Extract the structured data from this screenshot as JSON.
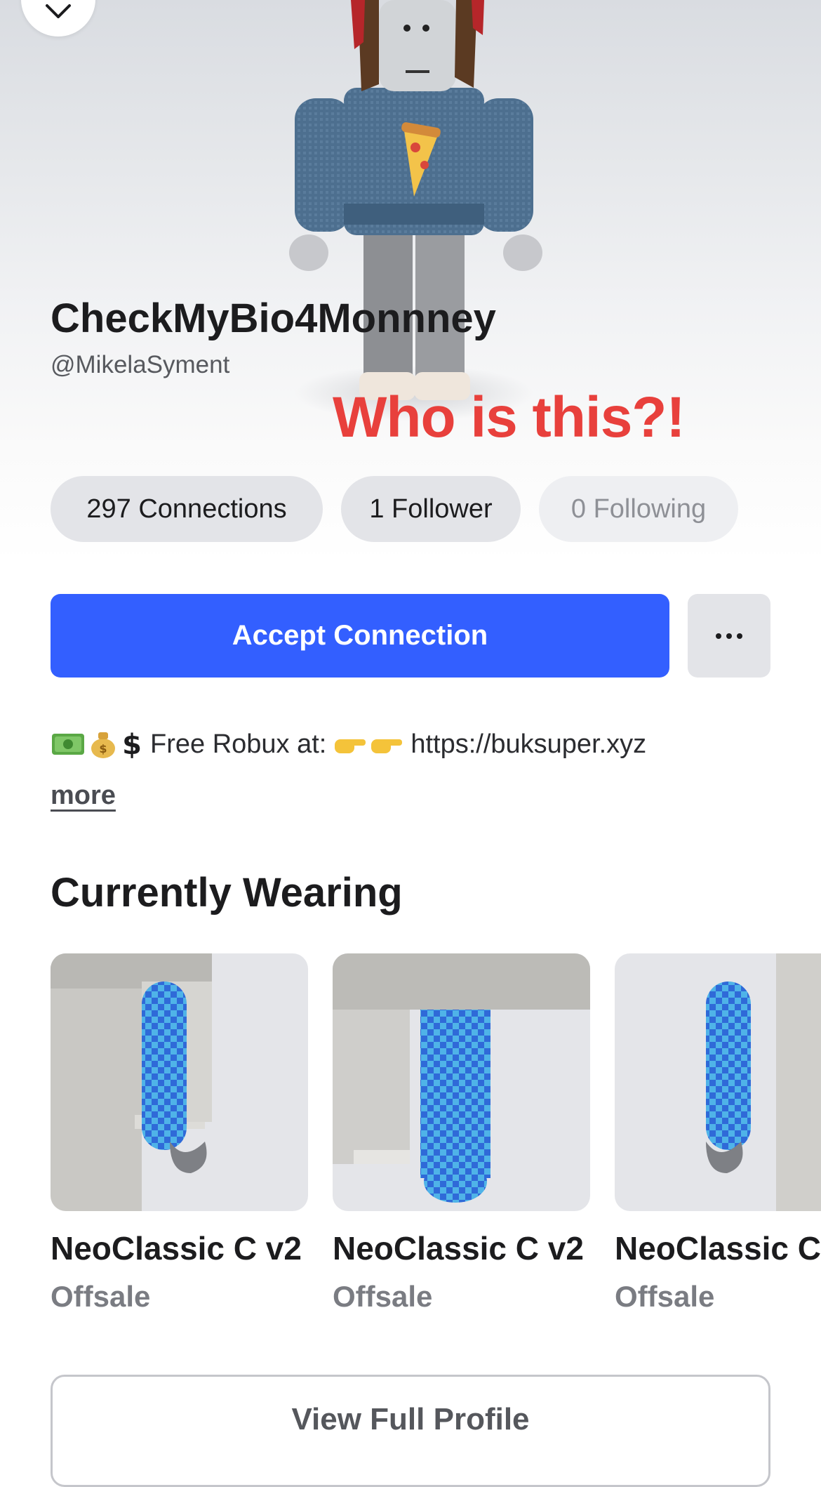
{
  "profile": {
    "display_name": "CheckMyBio4Monnney",
    "username": "@MikelaSyment"
  },
  "annotation": "Who is this?!",
  "stats": {
    "connections": "297 Connections",
    "followers": "1 Follower",
    "following": "0 Following"
  },
  "actions": {
    "accept_label": "Accept Connection",
    "more_label": "..."
  },
  "bio": {
    "text": "Free Robux at:",
    "link": "https://buksuper.xyz",
    "more": "more",
    "emojis": [
      "money-bill-icon",
      "money-bag-icon",
      "dollar-sign-icon",
      "pointing-hand-icon",
      "pointing-hand-icon"
    ]
  },
  "wearing": {
    "title": "Currently Wearing",
    "items": [
      {
        "name": "NeoClassic C v2",
        "status": "Offsale"
      },
      {
        "name": "NeoClassic C v2",
        "status": "Offsale"
      },
      {
        "name": "NeoClassic C",
        "status": "Offsale"
      }
    ]
  },
  "footer": {
    "view_full_profile": "View Full Profile"
  },
  "colors": {
    "accent": "#335fff",
    "annotation": "#e8403c",
    "pill_bg": "#e3e4e8"
  }
}
